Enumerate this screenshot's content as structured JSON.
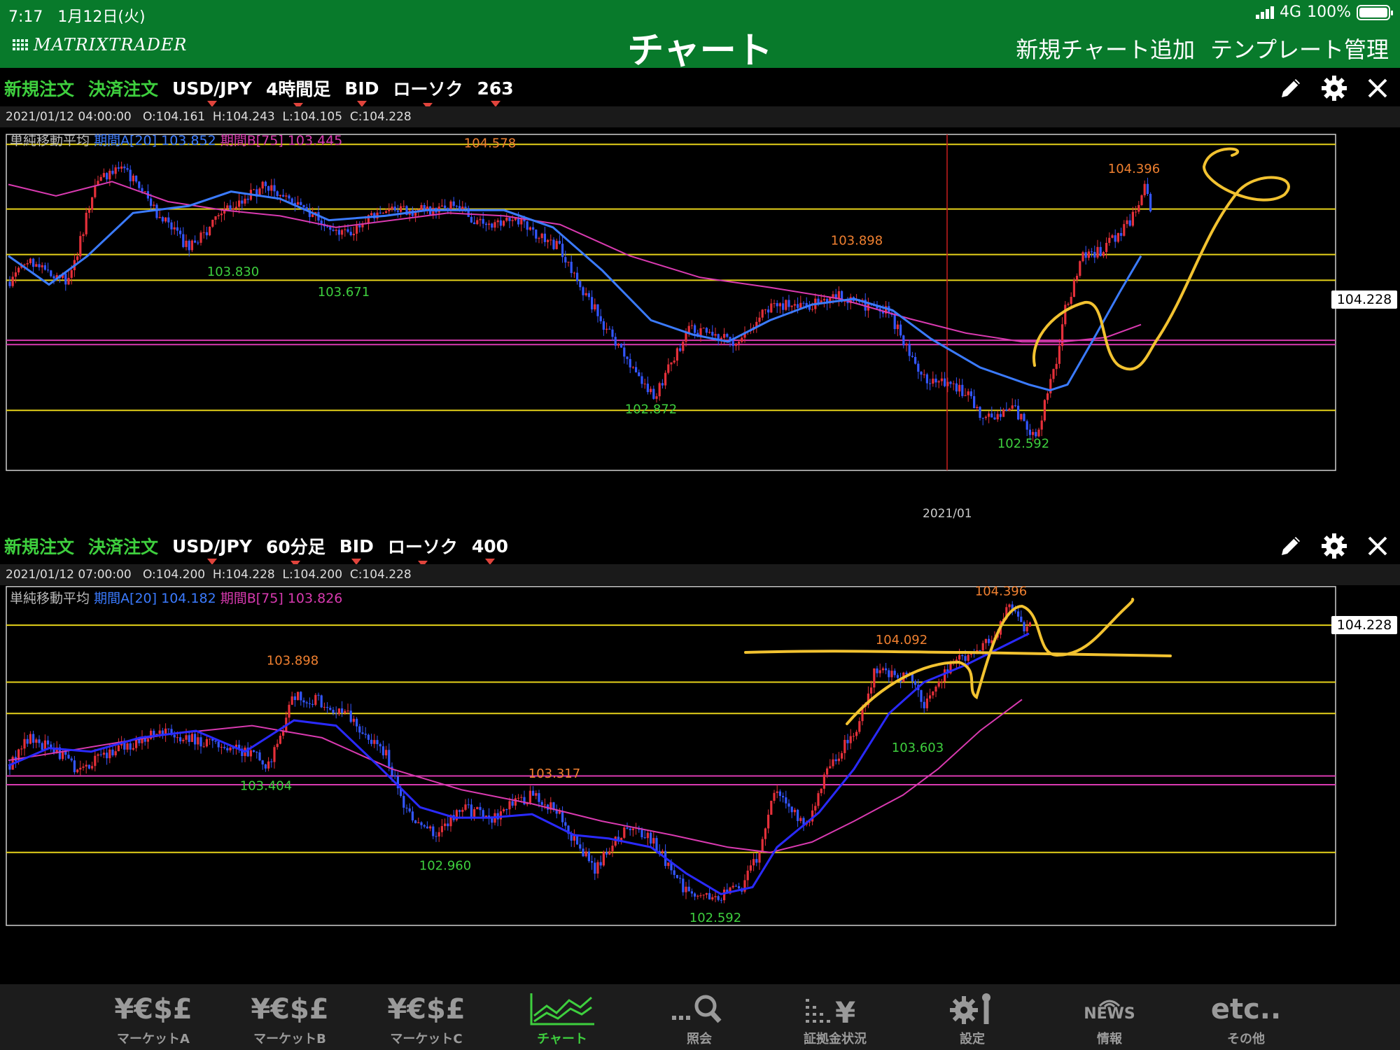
{
  "status": {
    "time": "7:17",
    "date": "1月12日(火)",
    "network": "4G",
    "battery": "100%",
    "battery_level": 1.0
  },
  "header": {
    "logo": "MATRIXTRADER",
    "title": "チャート",
    "add_chart": "新規チャート追加",
    "template": "テンプレート管理"
  },
  "charts": [
    {
      "toolbar": {
        "new_order": "新規注文",
        "close_order": "決済注文",
        "pair": "USD/JPY",
        "timeframe": "4時間足",
        "price_type": "BID",
        "chart_type": "ローソク",
        "bars": "263"
      },
      "ohlc": {
        "datetime": "2021/01/12 04:00:00",
        "open": "O:104.161",
        "high": "H:104.243",
        "low": "L:104.105",
        "close": "C:104.228"
      },
      "sma": {
        "label": "単純移動平均",
        "a_label": "期間A[20]",
        "a_value": "103.852",
        "b_label": "期間B[75]",
        "b_value": "103.445"
      },
      "current_price": "104.228",
      "x_label": "2021/01",
      "annotations": [
        {
          "text": "104.578",
          "type": "high"
        },
        {
          "text": "103.830",
          "type": "low"
        },
        {
          "text": "103.671",
          "type": "low"
        },
        {
          "text": "103.898",
          "type": "high"
        },
        {
          "text": "102.872",
          "type": "low"
        },
        {
          "text": "104.396",
          "type": "high"
        },
        {
          "text": "102.592",
          "type": "low"
        }
      ]
    },
    {
      "toolbar": {
        "new_order": "新規注文",
        "close_order": "決済注文",
        "pair": "USD/JPY",
        "timeframe": "60分足",
        "price_type": "BID",
        "chart_type": "ローソク",
        "bars": "400"
      },
      "ohlc": {
        "datetime": "2021/01/12 07:00:00",
        "open": "O:104.200",
        "high": "H:104.228",
        "low": "L:104.200",
        "close": "C:104.228"
      },
      "sma": {
        "label": "単純移動平均",
        "a_label": "期間A[20]",
        "a_value": "104.182",
        "b_label": "期間B[75]",
        "b_value": "103.826"
      },
      "current_price": "104.228",
      "annotations": [
        {
          "text": "103.898",
          "type": "high"
        },
        {
          "text": "103.404",
          "type": "low"
        },
        {
          "text": "103.317",
          "type": "high"
        },
        {
          "text": "102.960",
          "type": "low"
        },
        {
          "text": "104.396",
          "type": "high"
        },
        {
          "text": "104.092",
          "type": "high"
        },
        {
          "text": "103.603",
          "type": "low"
        },
        {
          "text": "102.592",
          "type": "low"
        }
      ]
    }
  ],
  "chart_data": [
    {
      "type": "candlestick",
      "pair": "USD/JPY",
      "timeframe": "4時間足",
      "current_price": 104.228,
      "sma20_last": 103.852,
      "sma75_last": 103.445,
      "labelled_extremes": [
        104.578,
        103.83,
        103.671,
        103.898,
        102.872,
        104.396,
        102.592
      ],
      "ylim": [
        102.4,
        104.75
      ]
    },
    {
      "type": "candlestick",
      "pair": "USD/JPY",
      "timeframe": "60分足",
      "current_price": 104.228,
      "sma20_last": 104.182,
      "sma75_last": 103.826,
      "labelled_extremes": [
        103.898,
        103.404,
        103.317,
        102.96,
        104.396,
        104.092,
        103.603,
        102.592
      ],
      "ylim": [
        102.5,
        104.45
      ]
    }
  ],
  "colors": {
    "header_green": "#087a2b",
    "order_green": "#3ecf3e",
    "bull": "#e5303a",
    "bear": "#3356ff",
    "sma_a": "#3b7bff",
    "sma_b": "#d93ab0",
    "hline": "#e6d21a",
    "drawing": "#f2c230",
    "high_label": "#f08030",
    "low_label": "#3ecf3e"
  },
  "tabs": [
    {
      "label": "マーケットA",
      "icon": "¥€$£"
    },
    {
      "label": "マーケットB",
      "icon": "¥€$£"
    },
    {
      "label": "マーケットC",
      "icon": "¥€$£"
    },
    {
      "label": "チャート",
      "icon": "chart-icon",
      "active": true
    },
    {
      "label": "照会",
      "icon": "search-icon"
    },
    {
      "label": "証拠金状況",
      "icon": "margin-icon"
    },
    {
      "label": "設定",
      "icon": "settings-icon"
    },
    {
      "label": "情報",
      "icon": "NEWS"
    },
    {
      "label": "その他",
      "icon": "etc.."
    }
  ]
}
